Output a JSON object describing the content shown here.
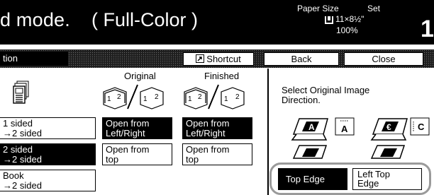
{
  "header": {
    "mode_title": "d mode.",
    "color_mode": "( Full-Color )",
    "paper_size_label": "Paper Size",
    "set_label": "Set",
    "paper_size_value": "11×8½\"",
    "zoom": "100%",
    "copy_count": "1"
  },
  "toolbar": {
    "function_tab": "tion",
    "shortcut": "Shortcut",
    "back": "Back",
    "close": "Close"
  },
  "main": {
    "original_label": "Original",
    "finished_label": "Finished",
    "duplex_options": [
      {
        "line1": "1 sided",
        "line2": "→2 sided",
        "selected": false
      },
      {
        "line1": "2 sided",
        "line2": "→2 sided",
        "selected": true
      },
      {
        "line1": "Book",
        "line2": "→2 sided",
        "selected": false
      }
    ],
    "original_binding": [
      {
        "line1": "Open from",
        "line2": "Left/Right",
        "selected": true
      },
      {
        "line1": "Open from",
        "line2": "top",
        "selected": false
      }
    ],
    "finished_binding": [
      {
        "line1": "Open from",
        "line2": "Left/Right",
        "selected": true
      },
      {
        "line1": "Open from",
        "line2": "top",
        "selected": false
      }
    ]
  },
  "direction": {
    "text_line1": "Select Original Image",
    "text_line2": "Direction.",
    "top_edge": "Top Edge",
    "left_top_edge_line1": "Left Top",
    "left_top_edge_line2": "Edge",
    "selected": "top_edge"
  },
  "icons": {
    "paper": "paper-tray-icon",
    "shortcut": "shortcut-icon",
    "duplex": "duplex-document-icon",
    "page_a": "page-a-icon",
    "copier": "copier-icon"
  }
}
